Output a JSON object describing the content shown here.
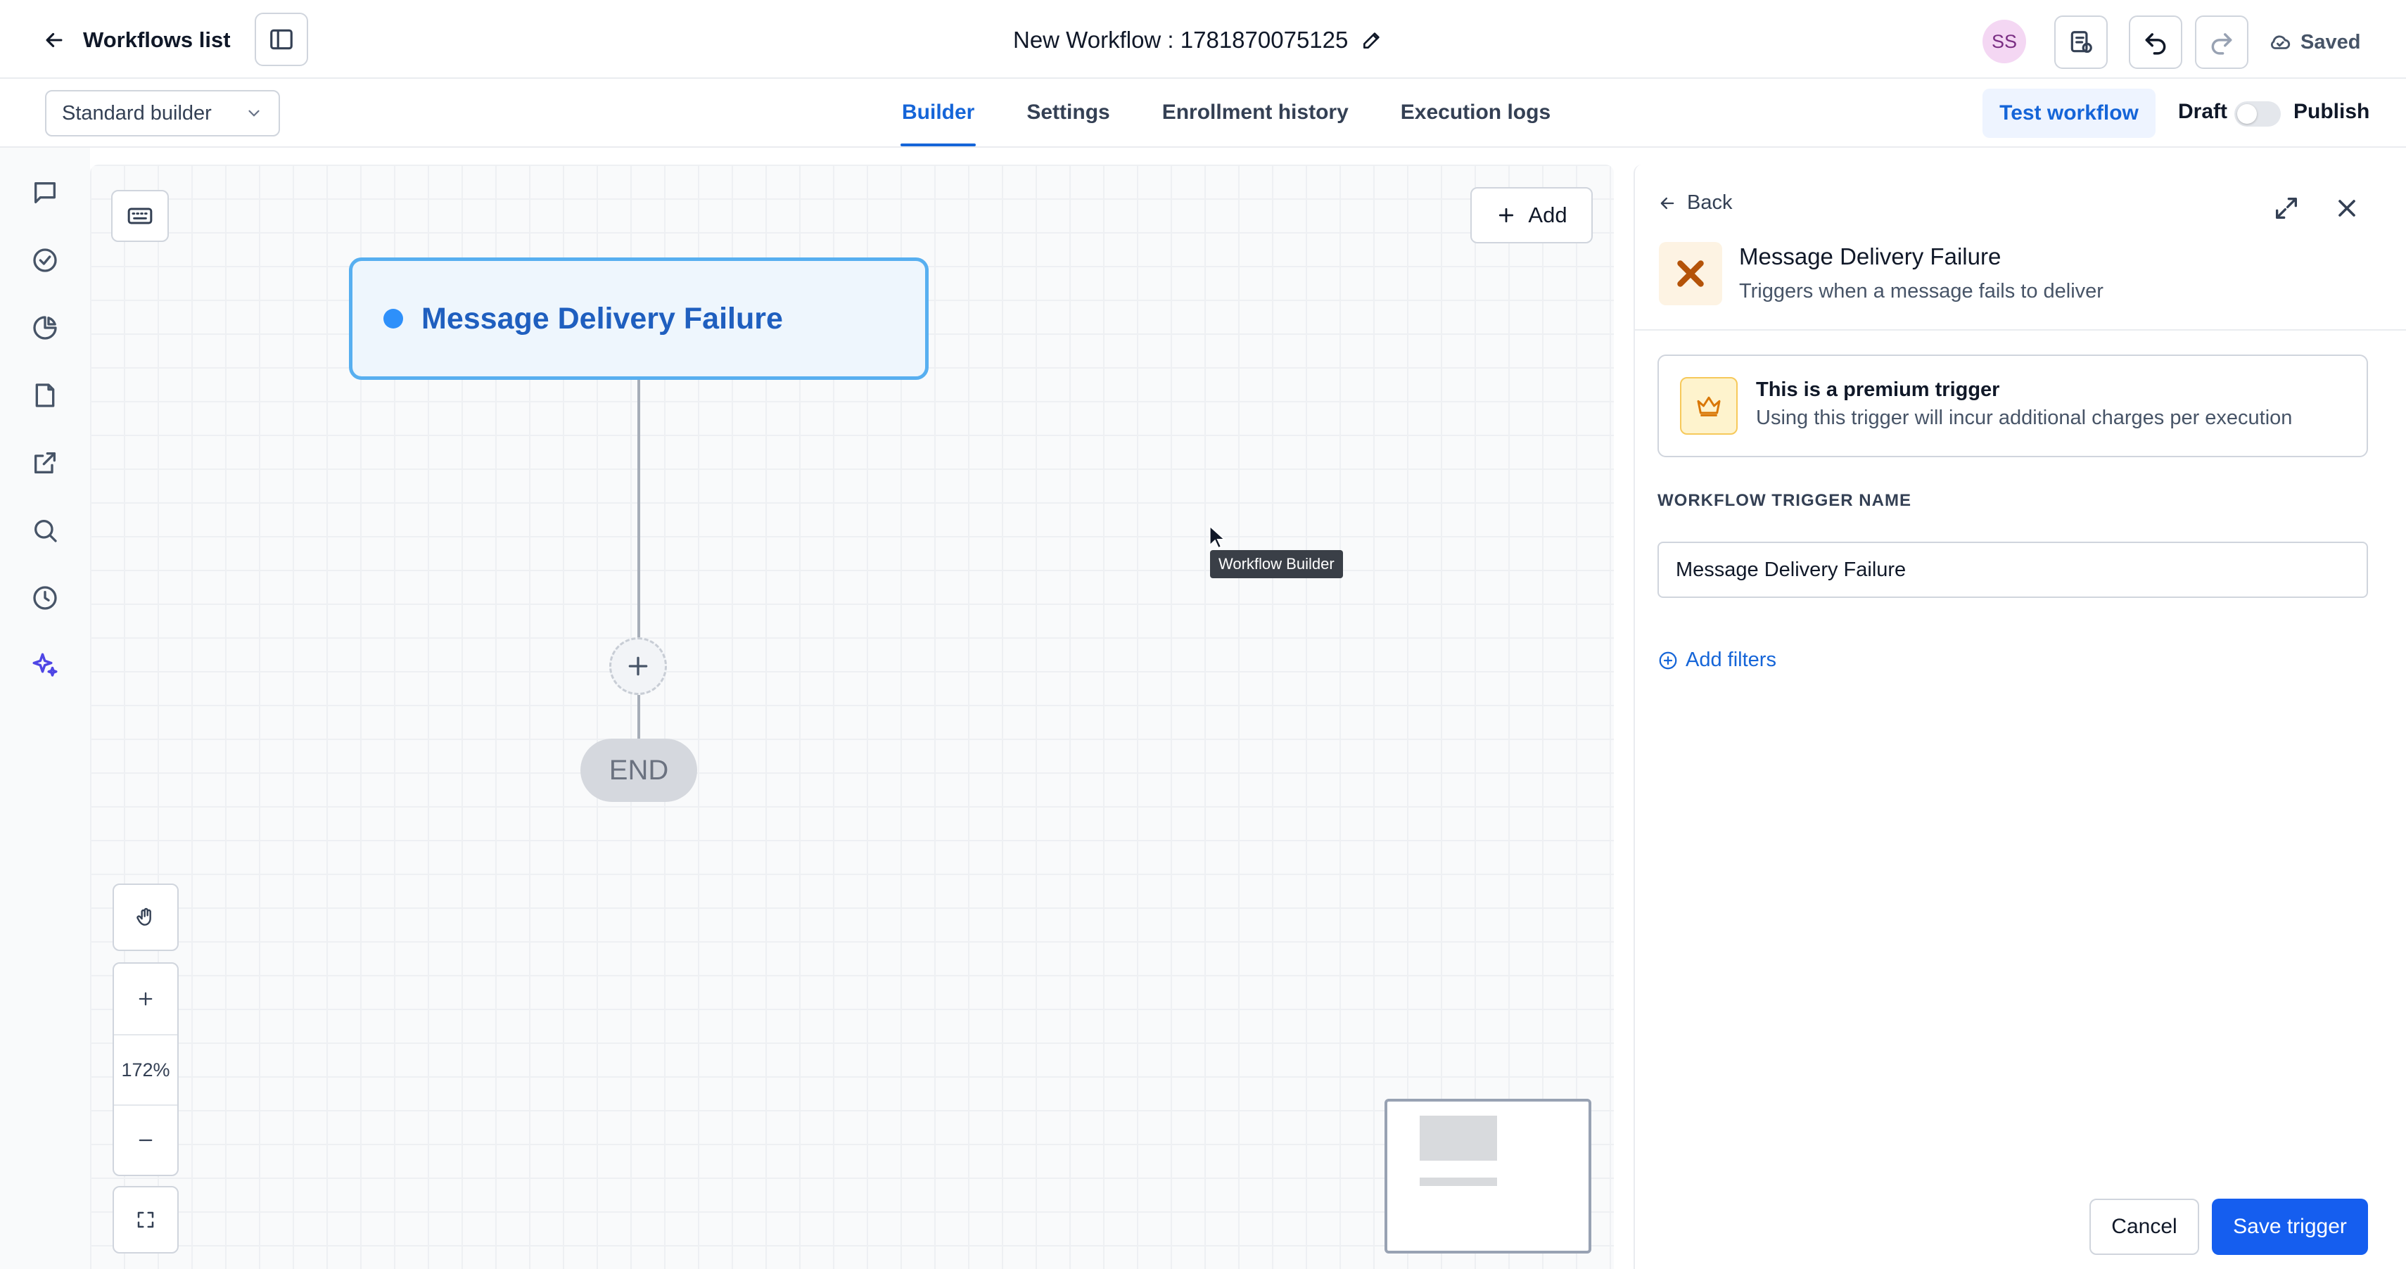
{
  "header": {
    "back_label": "Workflows list",
    "workflow_title": "New Workflow : 1781870075125",
    "avatar_initials": "SS",
    "saved_label": "Saved"
  },
  "subheader": {
    "builder_mode": "Standard builder",
    "tabs": [
      {
        "label": "Builder",
        "active": true
      },
      {
        "label": "Settings"
      },
      {
        "label": "Enrollment history"
      },
      {
        "label": "Execution logs"
      }
    ],
    "test_label": "Test workflow",
    "draft_label": "Draft",
    "publish_label": "Publish"
  },
  "canvas": {
    "add_label": "Add",
    "trigger_node_label": "Message Delivery Failure",
    "end_label": "END",
    "tooltip": "Workflow Builder",
    "zoom": "172%"
  },
  "panel": {
    "back_label": "Back",
    "trigger_title": "Message Delivery Failure",
    "trigger_subtitle": "Triggers when a message fails to deliver",
    "premium_title": "This is a premium trigger",
    "premium_subtitle": "Using this trigger will incur additional charges per execution",
    "field_label": "WORKFLOW TRIGGER NAME",
    "field_value": "Message Delivery Failure",
    "add_filters": "Add filters",
    "cancel_label": "Cancel",
    "save_label": "Save trigger"
  },
  "colors": {
    "accent": "#1565d8",
    "save_button": "#155eef",
    "node_border": "#57aff0",
    "node_fill": "#eef6fd"
  }
}
